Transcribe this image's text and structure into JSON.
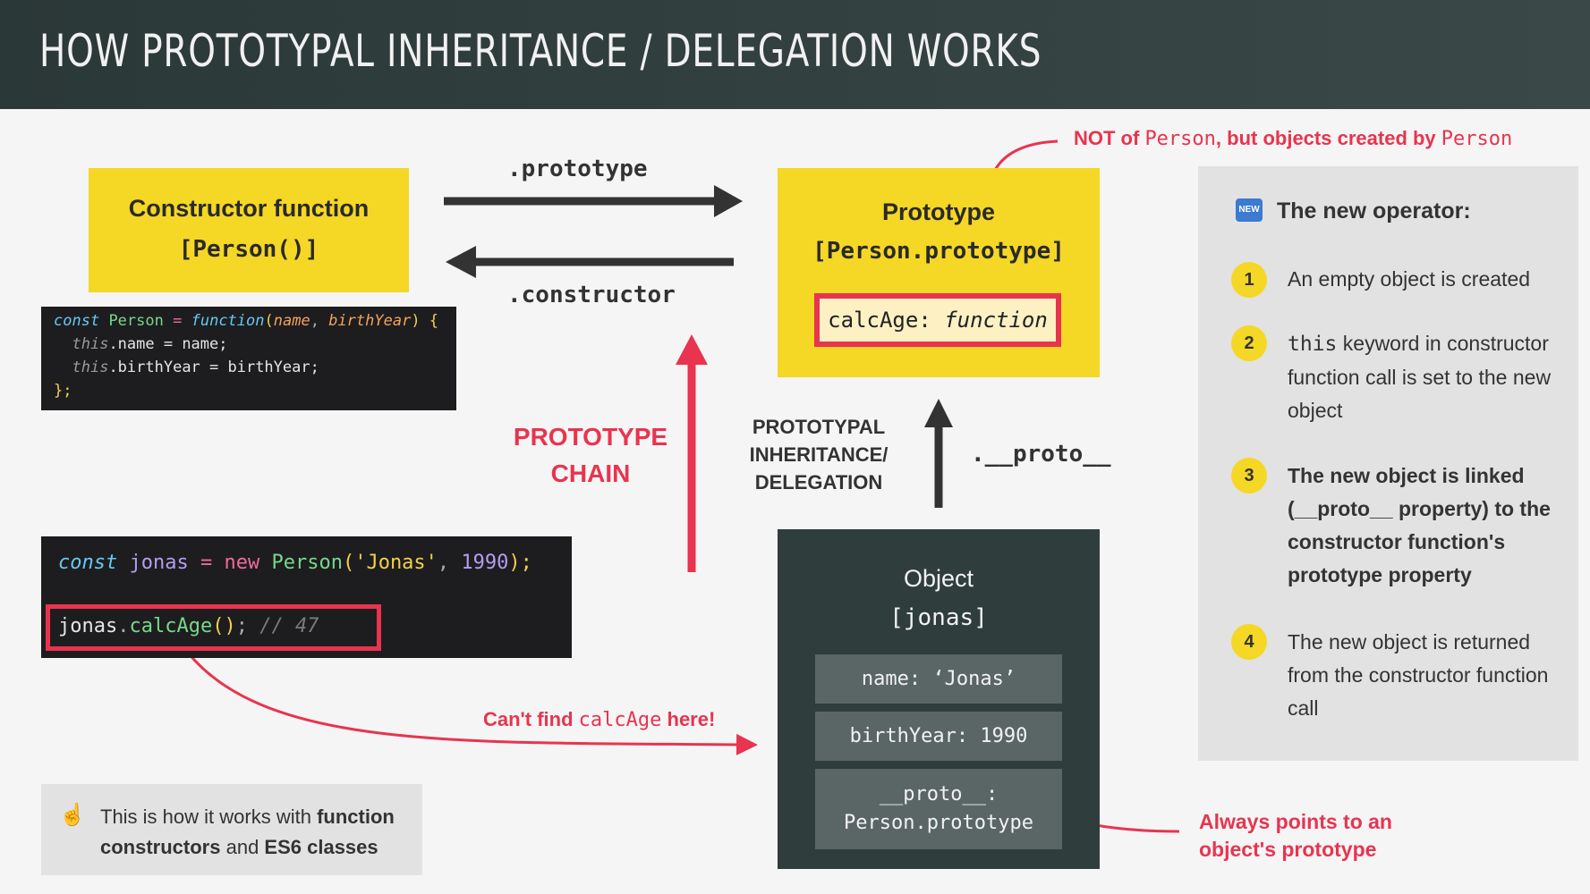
{
  "header": {
    "title": "HOW PROTOTYPAL INHERITANCE / DELEGATION WORKS"
  },
  "constructor_box": {
    "title": "Constructor function",
    "subtitle": "[Person()]"
  },
  "code_block_1": {
    "l1_kw": "const",
    "l1_name": "Person",
    "l1_eq": "=",
    "l1_fn": "function",
    "l1_p1": "name",
    "l1_comma": ",",
    "l1_p2": "birthYear",
    "l1_rest": ") {",
    "l2_this": "this",
    "l2_rest": ".name = name;",
    "l3_this": "this",
    "l3_rest": ".birthYear = birthYear;",
    "l4": "};"
  },
  "arrows": {
    "prototype_label": ".prototype",
    "constructor_label": ".constructor",
    "proto_label": ".__proto__"
  },
  "prototype_box": {
    "title": "Prototype",
    "subtitle": "[Person.prototype]",
    "method_key": "calcAge:",
    "method_value": "function"
  },
  "notes": {
    "not_of_1": "NOT of ",
    "not_of_2": "Person",
    "not_of_3": ", but objects ",
    "not_of_4": "created by ",
    "not_of_5": "Person",
    "cant_find_1": "Can't find ",
    "cant_find_2": "calcAge",
    "cant_find_3": " here!",
    "always_points_1": "Always points to an",
    "always_points_2": "object's prototype"
  },
  "chain_label": {
    "line1": "PROTOTYPE",
    "line2": "CHAIN"
  },
  "inheritance_label": {
    "line1": "PROTOTYPAL",
    "line2": "INHERITANCE/",
    "line3": "DELEGATION"
  },
  "code_block_2": {
    "kw": "const",
    "var": "jonas",
    "eq": "=",
    "new": "new",
    "cls": "Person",
    "paren": "(",
    "str": "'Jonas'",
    "comma": ", ",
    "num": "1990",
    "end": ");",
    "l2_obj": "jonas",
    "l2_dot": ".",
    "l2_fn": "calcAge",
    "l2_paren": "()",
    "l2_semi": ";",
    "l2_comment": "// 47"
  },
  "object_box": {
    "title": "Object",
    "subtitle": "[jonas]",
    "prop_name": "name: ‘Jonas’",
    "prop_birth": "birthYear: 1990",
    "prop_proto_1": "__proto__:",
    "prop_proto_2": "Person.prototype"
  },
  "bottom_note": {
    "icon": "☝",
    "t1": "This is how it works with ",
    "t2": "function constructors",
    "t3": " and ",
    "t4": "ES6 classes"
  },
  "panel": {
    "badge": "NEW",
    "title": "The new operator:",
    "steps": [
      {
        "num": "1",
        "text": "An empty object is created"
      },
      {
        "num": "2",
        "code": "this",
        "text": " keyword in constructor function call is set to the new object"
      },
      {
        "num": "3",
        "text": "The new object is linked (__proto__ property) to the constructor function's prototype property"
      },
      {
        "num": "4",
        "text": "The new object is returned from the constructor function call"
      }
    ]
  },
  "colors": {
    "yellow": "#f5d725",
    "dark": "#2f3d3d",
    "red": "#e8344f",
    "header": "#2b3838"
  }
}
